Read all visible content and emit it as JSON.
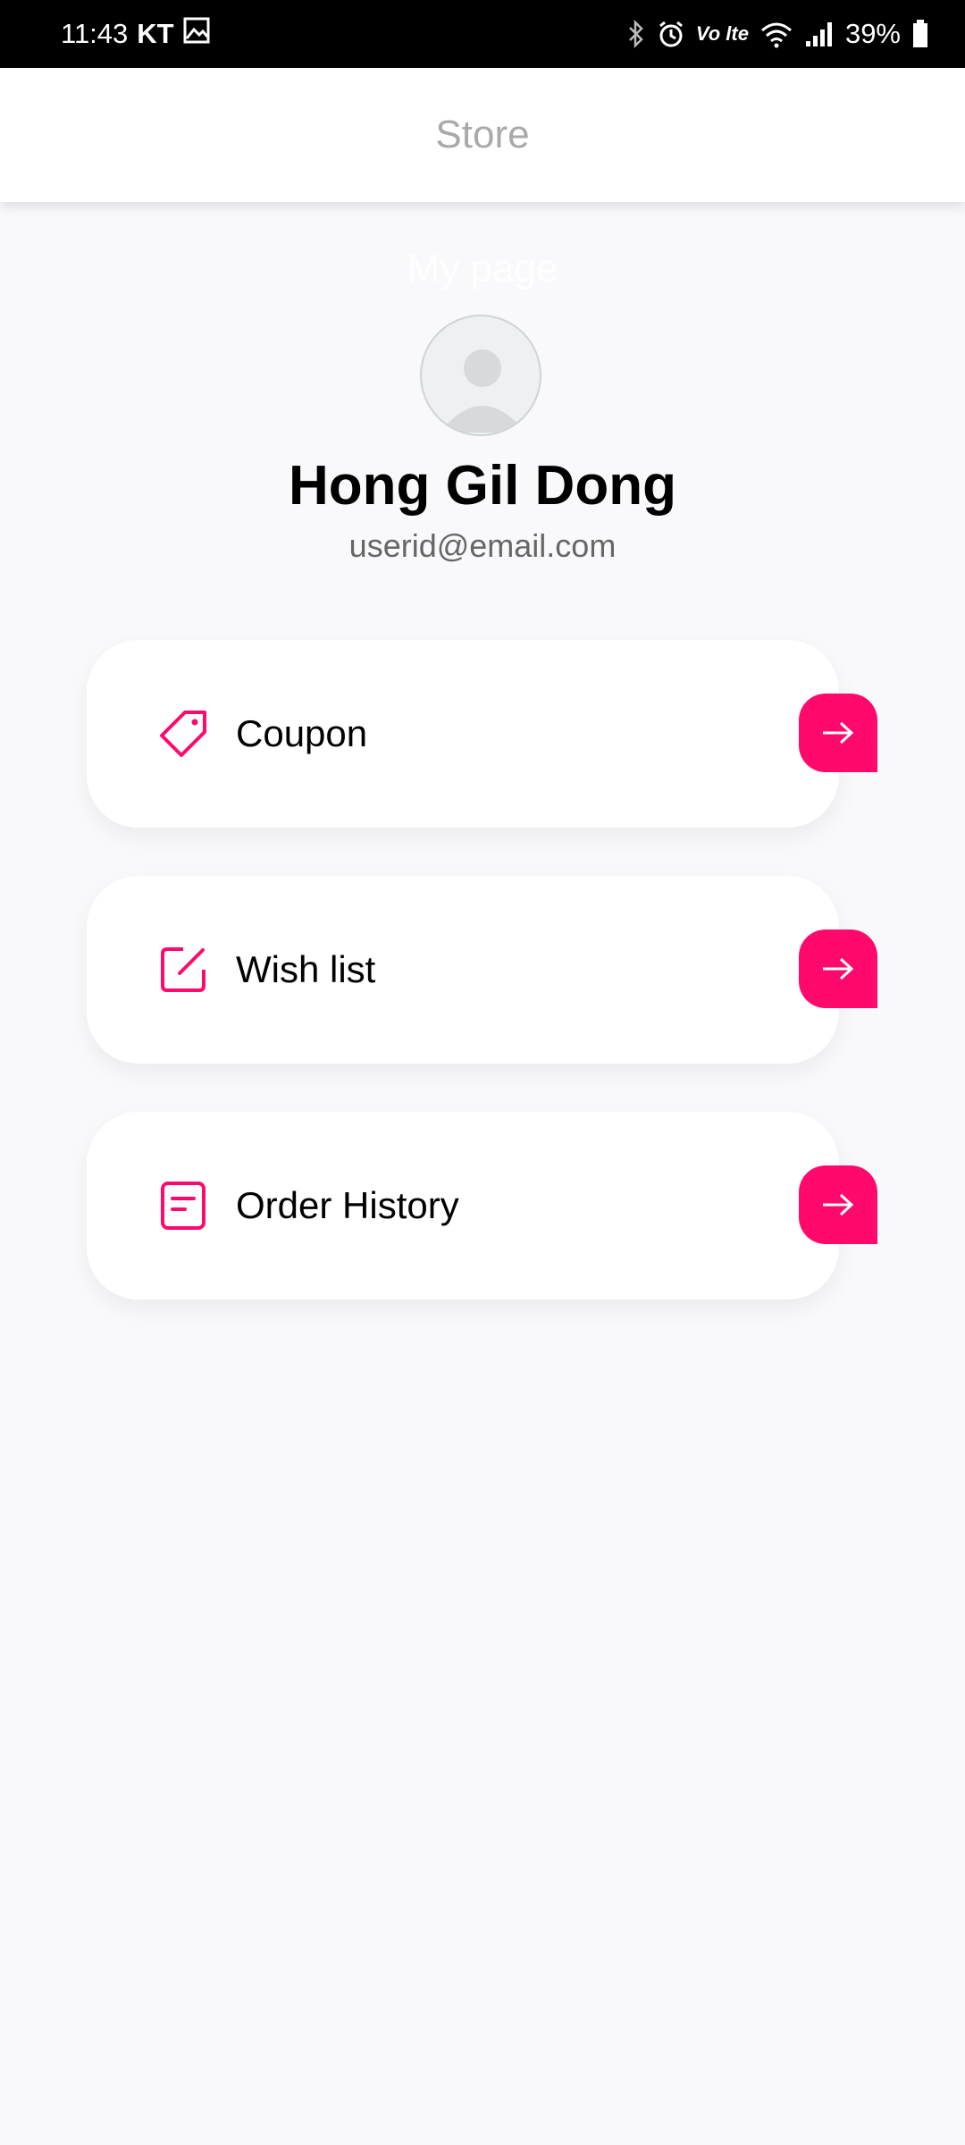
{
  "status_bar": {
    "time": "11:43",
    "carrier": "KT",
    "network": "Vo lte",
    "battery": "39%"
  },
  "app_bar": {
    "title": "Store"
  },
  "profile": {
    "section_title": "My page",
    "name": "Hong Gil Dong",
    "email": "userid@email.com"
  },
  "menu": {
    "items": [
      {
        "label": "Coupon",
        "icon": "tag-icon"
      },
      {
        "label": "Wish list",
        "icon": "edit-square-icon"
      },
      {
        "label": "Order History",
        "icon": "document-icon"
      }
    ]
  },
  "colors": {
    "accent": "#ff0a6c",
    "background": "#f9f9fc",
    "title_gray": "#a9a9a9"
  }
}
